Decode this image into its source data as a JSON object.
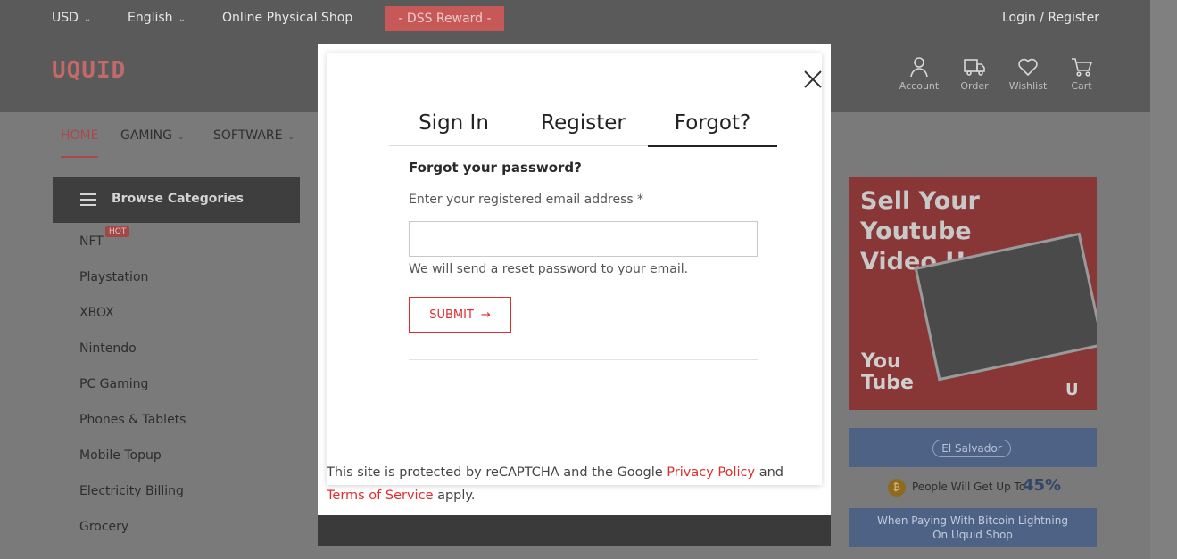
{
  "topbar": {
    "currency": "USD",
    "language": "English",
    "shop_link": "Online Physical Shop",
    "reward_label": "- DSS Reward -",
    "login_register": "Login / Register"
  },
  "header": {
    "logo": "UQUID",
    "icons": [
      {
        "name": "account-icon",
        "label": "Account"
      },
      {
        "name": "order-icon",
        "label": "Order"
      },
      {
        "name": "wishlist-icon",
        "label": "Wishlist"
      },
      {
        "name": "cart-icon",
        "label": "Cart"
      }
    ]
  },
  "nav": {
    "items": [
      "HOME",
      "GAMING",
      "SOFTWARE"
    ]
  },
  "sidebar": {
    "title": "Browse Categories",
    "hot_badge": "HOT",
    "items": [
      "NFT",
      "Playstation",
      "XBOX",
      "Nintendo",
      "PC Gaming",
      "Phones & Tablets",
      "Mobile Topup",
      "Electricity Billing",
      "Grocery"
    ]
  },
  "banner": {
    "line1": "Sell Your Youtube",
    "line2": "Video Here",
    "brand_line1": "You",
    "brand_line2": "Tube"
  },
  "promo": {
    "country": "El Salvador",
    "text": "People Will Get Up To",
    "percent": "45%",
    "bottom_line1": "When Paying With Bitcoin Lightning",
    "bottom_line2": "On Uquid Shop"
  },
  "modal": {
    "tabs": [
      "Sign In",
      "Register",
      "Forgot?"
    ],
    "active_tab": "Forgot?",
    "title": "Forgot your password?",
    "email_label": "Enter your registered email address *",
    "email_value": "",
    "hint": "We will send a reset password to your email.",
    "submit_label": "SUBMIT",
    "submit_arrow": "→",
    "captcha_prefix": "This site is protected by reCAPTCHA and the Google ",
    "privacy_link": "Privacy Policy",
    "captcha_and": " and ",
    "terms_link": "Terms of Service",
    "captcha_suffix": " apply."
  },
  "colors": {
    "accent": "#e02d2d",
    "overlay_dark": "#5a5a5a"
  }
}
